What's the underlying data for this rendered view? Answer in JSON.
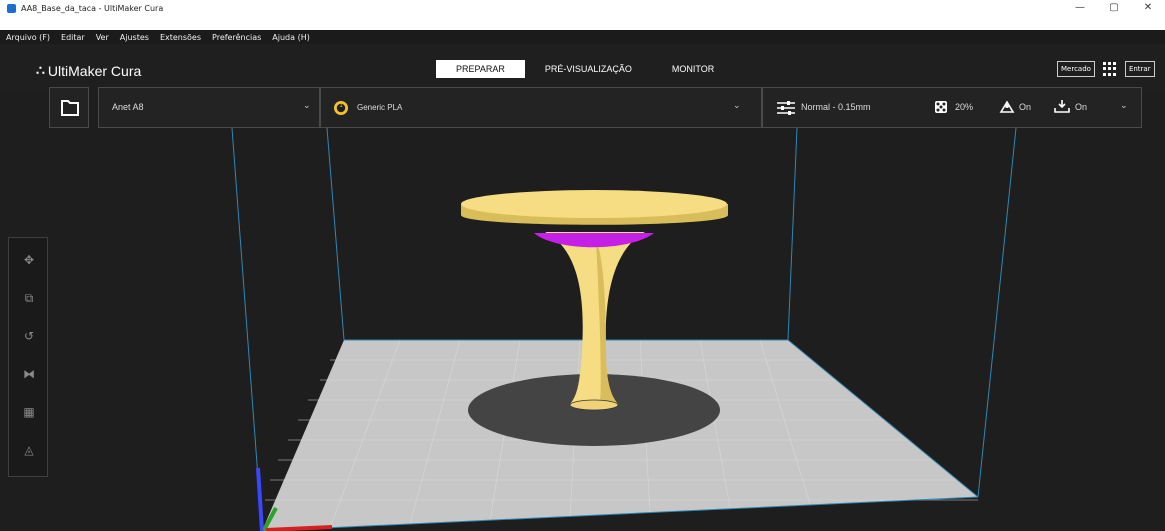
{
  "window": {
    "title": "AA8_Base_da_taca - UltiMaker Cura",
    "controls": {
      "minimize": "—",
      "restore": "▢",
      "close": "✕"
    }
  },
  "menu": [
    "Arquivo (F)",
    "Editar",
    "Ver",
    "Ajustes",
    "Extensões",
    "Preferências",
    "Ajuda (H)"
  ],
  "app": {
    "logo_mark": "∴",
    "logo_text": "UltiMaker Cura"
  },
  "stages": [
    "PREPARAR",
    "PRÉ-VISUALIZAÇÃO",
    "MONITOR"
  ],
  "active_stage": "PREPARAR",
  "header_right": {
    "marketplace": "Mercado",
    "signin": "Entrar"
  },
  "printer": {
    "name": "Anet A8"
  },
  "material": {
    "extruder": "1",
    "name": "Generic PLA"
  },
  "print_settings": {
    "profile": "Normal - 0.15mm",
    "infill": "20%",
    "support": "On",
    "adhesion": "On"
  },
  "side_tools": [
    "move-tool",
    "scale-tool",
    "rotate-tool",
    "mirror-tool",
    "per-model-settings-tool",
    "support-blocker-tool"
  ],
  "colors": {
    "model": "#f6dc82",
    "model_side": "#d9bd5a",
    "overhang": "#c521e6",
    "bed": "#c7c7c7",
    "shadow": "#444444",
    "volume_edges": "#2f88b8"
  }
}
